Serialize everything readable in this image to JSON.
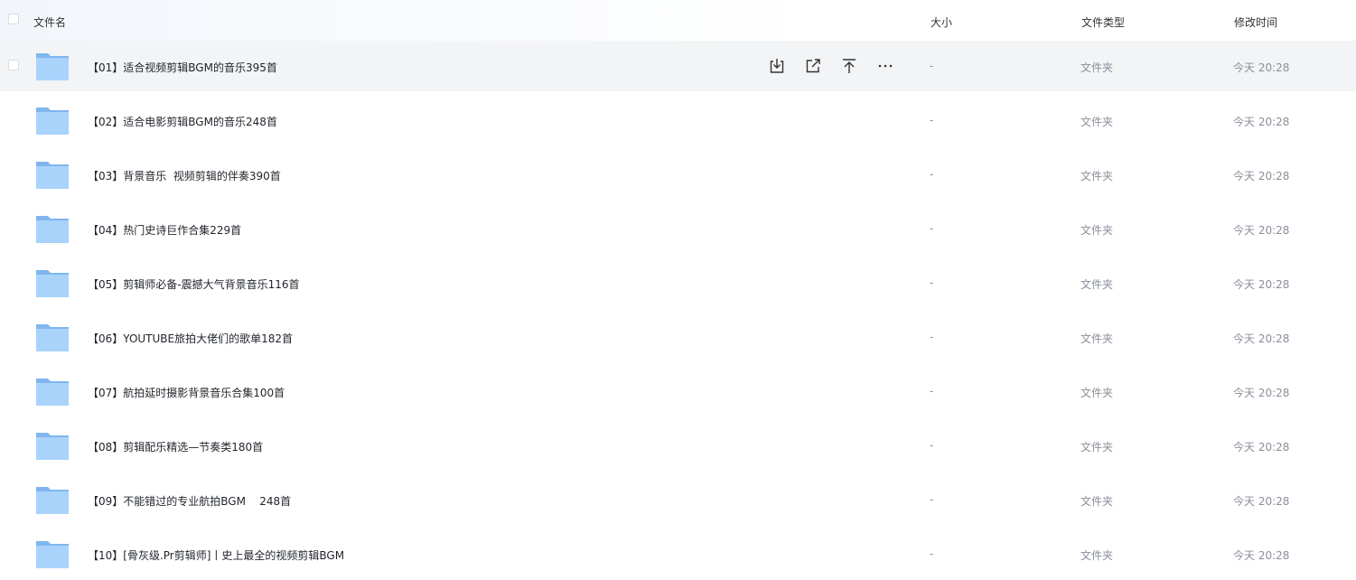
{
  "header": {
    "name": "文件名",
    "size": "大小",
    "type": "文件类型",
    "time": "修改时间"
  },
  "rows": [
    {
      "name": "【01】适合视频剪辑BGM的音乐395首",
      "size": "-",
      "type": "文件夹",
      "time": "今天 20:28"
    },
    {
      "name": "【02】适合电影剪辑BGM的音乐248首",
      "size": "-",
      "type": "文件夹",
      "time": "今天 20:28"
    },
    {
      "name": "【03】背景音乐  视频剪辑的伴奏390首",
      "size": "-",
      "type": "文件夹",
      "time": "今天 20:28"
    },
    {
      "name": "【04】热门史诗巨作合集229首",
      "size": "-",
      "type": "文件夹",
      "time": "今天 20:28"
    },
    {
      "name": "【05】剪辑师必备-震撼大气背景音乐116首",
      "size": "-",
      "type": "文件夹",
      "time": "今天 20:28"
    },
    {
      "name": "【06】YOUTUBE旅拍大佬们的歌单182首",
      "size": "-",
      "type": "文件夹",
      "time": "今天 20:28"
    },
    {
      "name": "【07】航拍延时摄影背景音乐合集100首",
      "size": "-",
      "type": "文件夹",
      "time": "今天 20:28"
    },
    {
      "name": "【08】剪辑配乐精选—节奏类180首",
      "size": "-",
      "type": "文件夹",
      "time": "今天 20:28"
    },
    {
      "name": "【09】不能错过的专业航拍BGM    248首",
      "size": "-",
      "type": "文件夹",
      "time": "今天 20:28"
    },
    {
      "name": "【10】[骨灰级.Pr剪辑师]丨史上最全的视频剪辑BGM",
      "size": "-",
      "type": "文件夹",
      "time": "今天 20:28"
    }
  ],
  "row_actions": [
    "download-icon",
    "share-icon",
    "move-to-top-icon",
    "more-icon"
  ],
  "colors": {
    "folder_back": "#7fb6ee",
    "folder_front": "#a9d3fb",
    "hover_row": "#f3f4f6",
    "muted_text": "#8a8f99"
  }
}
